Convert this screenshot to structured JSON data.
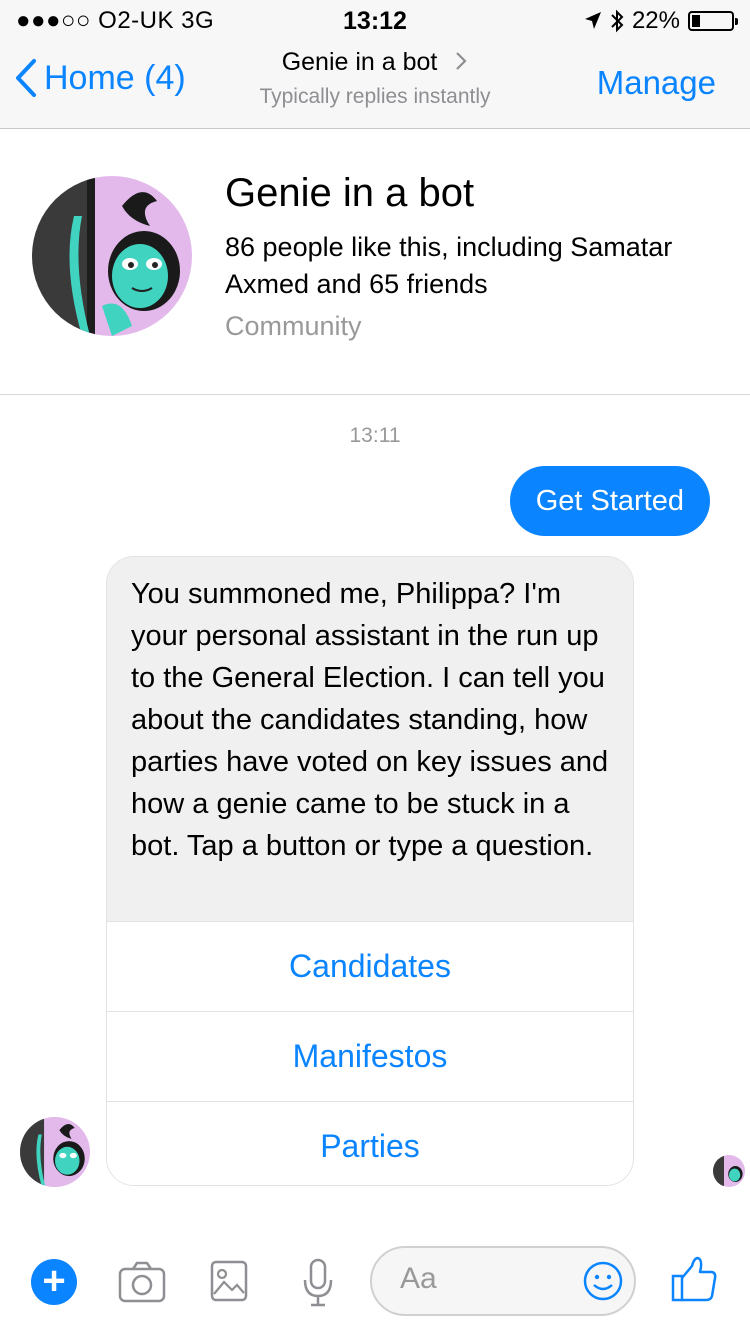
{
  "status_bar": {
    "carrier": "●●●○○ O2-UK   3G",
    "time": "13:12",
    "battery_percent": "22%",
    "battery_level": 0.22
  },
  "nav": {
    "back_label": "Home (4)",
    "title": "Genie in a bot",
    "subtitle": "Typically replies instantly",
    "manage_label": "Manage"
  },
  "page": {
    "name": "Genie in a bot",
    "likes": "86 people like this, including Samatar Axmed and 65 friends",
    "category": "Community"
  },
  "conversation": {
    "timestamp": "13:11",
    "outgoing": "Get Started",
    "incoming": "You summoned me, Philippa? I'm your personal assistant in the run up to the General Election. I can tell you about the candidates standing, how parties have voted on key issues and how a genie came to be stuck in a bot. Tap a button or type a question.",
    "buttons": [
      "Candidates",
      "Manifestos",
      "Parties"
    ]
  },
  "composer": {
    "placeholder": "Aa"
  },
  "colors": {
    "accent": "#0a84ff",
    "bubble_gray": "#f1f0f0",
    "genie_teal": "#3fd3c0",
    "genie_purple": "#e3b9ec"
  }
}
